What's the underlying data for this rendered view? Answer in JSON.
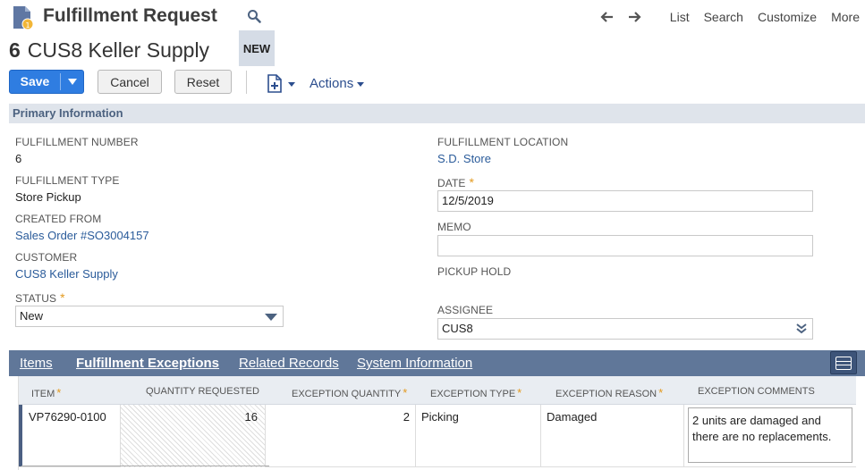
{
  "header": {
    "title": "Fulfillment Request",
    "nav": {
      "list": "List",
      "search": "Search",
      "customize": "Customize",
      "more": "More"
    }
  },
  "record": {
    "number": "6",
    "name": "CUS8 Keller Supply",
    "status_tag": "NEW"
  },
  "toolbar": {
    "save": "Save",
    "cancel": "Cancel",
    "reset": "Reset",
    "actions": "Actions"
  },
  "section": {
    "title": "Primary Information",
    "left": {
      "fulfillment_number": {
        "label": "FULFILLMENT NUMBER",
        "value": "6"
      },
      "fulfillment_type": {
        "label": "FULFILLMENT TYPE",
        "value": "Store Pickup"
      },
      "created_from": {
        "label": "CREATED FROM",
        "value": "Sales Order #SO3004157"
      },
      "customer": {
        "label": "CUSTOMER",
        "value": "CUS8 Keller Supply"
      },
      "status": {
        "label": "STATUS",
        "value": "New"
      }
    },
    "right": {
      "location": {
        "label": "FULFILLMENT LOCATION",
        "value": "S.D. Store"
      },
      "date": {
        "label": "DATE",
        "value": "12/5/2019"
      },
      "memo": {
        "label": "MEMO",
        "value": ""
      },
      "pickup_hold": {
        "label": "PICKUP HOLD"
      },
      "assignee": {
        "label": "ASSIGNEE",
        "value": "CUS8"
      }
    }
  },
  "tabs": [
    "Items",
    "Fulfillment Exceptions",
    "Related Records",
    "System Information"
  ],
  "sublist": {
    "columns": [
      "ITEM",
      "QUANTITY REQUESTED",
      "EXCEPTION QUANTITY",
      "EXCEPTION TYPE",
      "EXCEPTION REASON",
      "EXCEPTION COMMENTS"
    ],
    "rows": [
      {
        "item": "VP76290-0100",
        "quantity_requested": "16",
        "exception_quantity": "2",
        "exception_type": "Picking",
        "exception_reason": "Damaged",
        "exception_comments": "2 units are damaged and there are no replacements."
      }
    ]
  },
  "colors": {
    "accent": "#2f7de1",
    "tabbar": "#607799",
    "link": "#2a5b9a",
    "required": "#e39a1f"
  }
}
